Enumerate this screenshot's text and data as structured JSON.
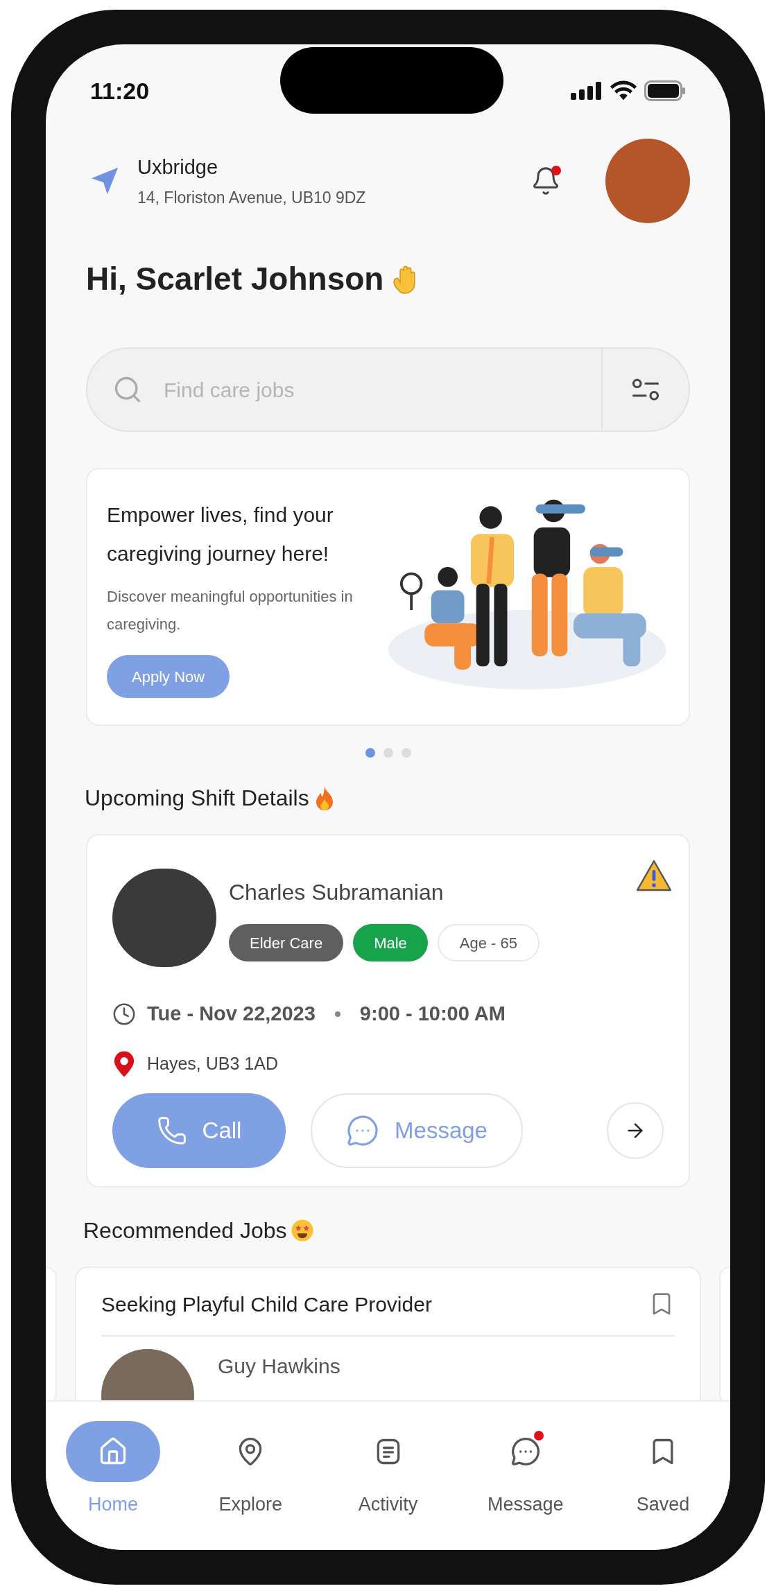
{
  "status_bar": {
    "time": "11:20"
  },
  "location": {
    "city": "Uxbridge",
    "address": "14, Floriston Avenue, UB10 9DZ"
  },
  "notifications": {
    "unread": true
  },
  "greeting": "Hi, Scarlet Johnson",
  "search": {
    "placeholder": "Find care jobs"
  },
  "banner": {
    "title": "Empower lives, find your caregiving journey here!",
    "subtitle": "Discover meaningful opportunities in caregiving.",
    "button": "Apply Now"
  },
  "carousel_dots": [
    {
      "selected": true
    },
    {
      "selected": false
    },
    {
      "selected": false
    }
  ],
  "upcoming": {
    "heading": "Upcoming Shift Details",
    "shift": {
      "name": "Charles Subramanian",
      "alert": true,
      "tags": [
        {
          "label": "Elder Care",
          "kind": "category"
        },
        {
          "label": "Male",
          "kind": "gender"
        },
        {
          "label": "Age - 65",
          "kind": "age"
        }
      ],
      "date": "Tue - Nov 22,2023",
      "time": "9:00 - 10:00 AM",
      "location": "Hayes, UB3 1AD",
      "call": "Call",
      "message": "Message"
    }
  },
  "recommended": {
    "heading": "Recommended Jobs",
    "jobs": [
      {
        "title": "Seeking Playful Child Care Provider",
        "saved": false,
        "person": "Guy Hawkins"
      }
    ]
  },
  "nav": [
    {
      "label": "Home",
      "kind": "home",
      "selected": true,
      "badge": false
    },
    {
      "label": "Explore",
      "kind": "explore",
      "selected": false,
      "badge": false
    },
    {
      "label": "Activity",
      "kind": "activity",
      "selected": false,
      "badge": false
    },
    {
      "label": "Message",
      "kind": "message",
      "selected": false,
      "badge": true
    },
    {
      "label": "Saved",
      "kind": "saved",
      "selected": false,
      "badge": false
    }
  ]
}
